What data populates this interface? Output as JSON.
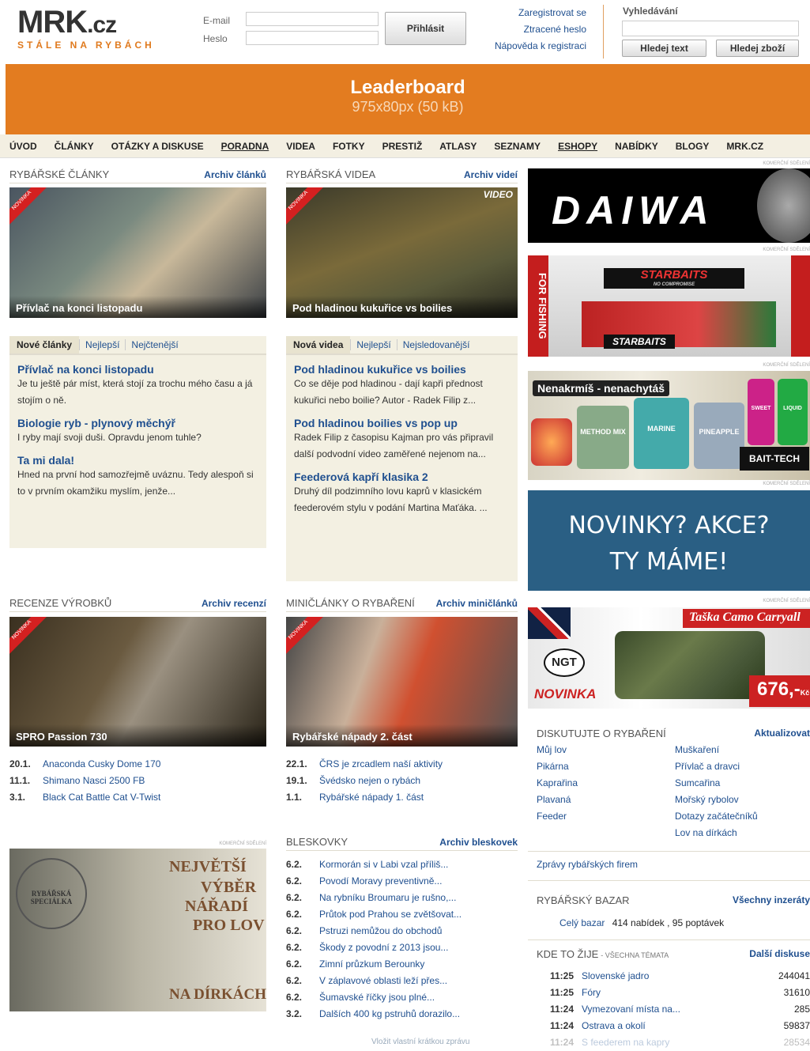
{
  "header": {
    "logo": "MRK",
    "logo_tld": ".cz",
    "tagline": "STÁLE NA RYBÁCH",
    "email_label": "E-mail",
    "password_label": "Heslo",
    "login_button": "Přihlásit",
    "register": "Zaregistrovat se",
    "lost_password": "Ztracené heslo",
    "register_help": "Nápověda k registraci",
    "search_title": "Vyhledávání",
    "search_text_button": "Hledej text",
    "search_goods_button": "Hledej zboží"
  },
  "leaderboard": {
    "title": "Leaderboard",
    "size": "975x80px (50 kB)"
  },
  "nav": [
    "ÚVOD",
    "ČLÁNKY",
    "OTÁZKY A DISKUSE",
    "PORADNA",
    "VIDEA",
    "FOTKY",
    "PRESTIŽ",
    "ATLASY",
    "SEZNAMY",
    "ESHOPY",
    "NABÍDKY",
    "BLOGY",
    "MRK.CZ"
  ],
  "articles": {
    "title": "RYBÁŘSKÉ ČLÁNKY",
    "archive": "Archiv článků",
    "photo_caption": "Přívlač na konci listopadu",
    "ribbon": "NOVINKA",
    "tabs": [
      "Nové články",
      "Nejlepší",
      "Nejčtenější"
    ],
    "items": [
      {
        "h": "Přívlač na konci listopadu",
        "p": "Je tu ještě pár míst, která stojí za trochu mého času a já stojím o ně."
      },
      {
        "h": "Biologie ryb - plynový měchýř",
        "p": "I ryby mají svoji duši. Opravdu jenom tuhle?"
      },
      {
        "h": "Ta mi dala!",
        "p": "Hned na první hod samozřejmě uváznu. Tedy alespoň si to v prvním okamžiku myslím, jenže..."
      }
    ]
  },
  "videos": {
    "title": "RYBÁŘSKÁ VIDEA",
    "archive": "Archiv videí",
    "photo_caption": "Pod hladinou kukuřice vs boilies",
    "video_tag": "VIDEO",
    "ribbon": "NOVINKA",
    "tabs": [
      "Nová videa",
      "Nejlepší",
      "Nejsledovanější"
    ],
    "items": [
      {
        "h": "Pod hladinou kukuřice vs boilies",
        "p": "Co se děje pod hladinou - dají kapři přednost kukuřici nebo boilie? Autor - Radek Filip z..."
      },
      {
        "h": "Pod hladinou boilies vs pop up",
        "p": "Radek Filip z časopisu Kajman pro vás připravil další podvodní video zaměřené nejenom na..."
      },
      {
        "h": "Feederová kapří klasika 2",
        "p": "Druhý díl podzimního lovu kaprů v klasickém feederovém stylu v podání Martina Maťáka. ..."
      }
    ]
  },
  "reviews": {
    "title": "RECENZE VÝROBKŮ",
    "archive": "Archiv recenzí",
    "photo_caption": "SPRO Passion 730",
    "ribbon": "NOVINKA",
    "items": [
      {
        "d": "20.1.",
        "t": "Anaconda Cusky Dome 170"
      },
      {
        "d": "11.1.",
        "t": "Shimano Nasci 2500 FB"
      },
      {
        "d": "3.1.",
        "t": "Black Cat Battle Cat V-Twist"
      }
    ]
  },
  "mini": {
    "title": "MINIČLÁNKY O RYBAŘENÍ",
    "archive": "Archiv miničlánků",
    "photo_caption": "Rybářské nápady 2. část",
    "ribbon": "NOVINKA",
    "items": [
      {
        "d": "22.1.",
        "t": "ČRS je zrcadlem naší aktivity"
      },
      {
        "d": "19.1.",
        "t": "Švédsko nejen o rybách"
      },
      {
        "d": "1.1.",
        "t": "Rybářské nápady 1. část"
      }
    ]
  },
  "news": {
    "title": "BLESKOVKY",
    "archive": "Archiv bleskovek",
    "footer": "Vložit vlastní krátkou zprávu",
    "items": [
      {
        "d": "6.2.",
        "t": "Kormorán si v Labi vzal příliš..."
      },
      {
        "d": "6.2.",
        "t": "Povodí Moravy preventivně..."
      },
      {
        "d": "6.2.",
        "t": "Na rybníku Broumaru je rušno,..."
      },
      {
        "d": "6.2.",
        "t": "Průtok pod Prahou se zvětšovat..."
      },
      {
        "d": "6.2.",
        "t": "Pstruzi nemůžou do obchodů"
      },
      {
        "d": "6.2.",
        "t": "Škody z povodní z 2013 jsou..."
      },
      {
        "d": "6.2.",
        "t": "Zimní průzkum Berounky"
      },
      {
        "d": "6.2.",
        "t": "V záplavové oblasti leží přes..."
      },
      {
        "d": "6.2.",
        "t": "Šumavské říčky jsou plné..."
      },
      {
        "d": "3.2.",
        "t": "Dalších 400 kg pstruhů dorazilo..."
      }
    ]
  },
  "ads": {
    "label": "KOMERČNÍ SDĚLENÍ",
    "daiwa": "DAIWA",
    "for_fishing": "FOR FISHING",
    "starbaits": "STARBAITS",
    "starbaits_sub": "NO COMPROMISE",
    "baittech": "Nenakrmíš - nenachytáš",
    "baittech_logo": "BAIT-TECH",
    "tub1": "METHOD MIX",
    "tub2": "MARINE",
    "tub3": "PINEAPPLE",
    "tub4": "LIQUID",
    "tub5": "SWEET",
    "novinky1": "NOVINKY? AKCE?",
    "novinky2": "TY MÁME!",
    "ngt_title": "Taška Camo Carryall",
    "ngt_logo": "NGT",
    "ngt_new": "NOVINKA",
    "ngt_price": "676,-",
    "ngt_currency": "Kč",
    "special_seal": "RYBÁŘSKÁ SPECIÁLKA",
    "special1": "NEJVĚTŠÍ",
    "special2": "VÝBĚR",
    "special3": "NÁŘADÍ",
    "special4": "PRO LOV",
    "special5": "NA DÍRKÁCH"
  },
  "discuss": {
    "title": "DISKUTUJTE O RYBAŘENÍ",
    "refresh": "Aktualizovat",
    "col1": [
      "Můj lov",
      "Pikárna",
      "Kaprařina",
      "Plavaná",
      "Feeder"
    ],
    "col2": [
      "Muškaření",
      "Přívlač a dravci",
      "Sumcařina",
      "Mořský rybolov",
      "Dotazy začátečníků",
      "Lov na dírkách"
    ],
    "firms": "Zprávy rybářských firem"
  },
  "bazar": {
    "title": "RYBÁŘSKÝ BAZAR",
    "all": "Všechny inzeráty",
    "label": "Celý bazar",
    "stats": "414 nabídek , 95 poptávek"
  },
  "live": {
    "title": "KDE TO ŽIJE",
    "subtitle": "- VŠECHNA TÉMATA",
    "more": "Další diskuse",
    "items": [
      {
        "time": "11:25",
        "t": "Slovenské jadro",
        "n": "244041"
      },
      {
        "time": "11:25",
        "t": "Fóry",
        "n": "31610"
      },
      {
        "time": "11:24",
        "t": "Vymezovaní místa na...",
        "n": "285"
      },
      {
        "time": "11:24",
        "t": "Ostrava a okolí",
        "n": "59837"
      },
      {
        "time": "11:24",
        "t": "S feederem na kapry",
        "n": "28534"
      }
    ]
  },
  "colors": {
    "accent": "#e37c20",
    "link": "#1f4f8f",
    "panel": "#f3f0e2"
  }
}
